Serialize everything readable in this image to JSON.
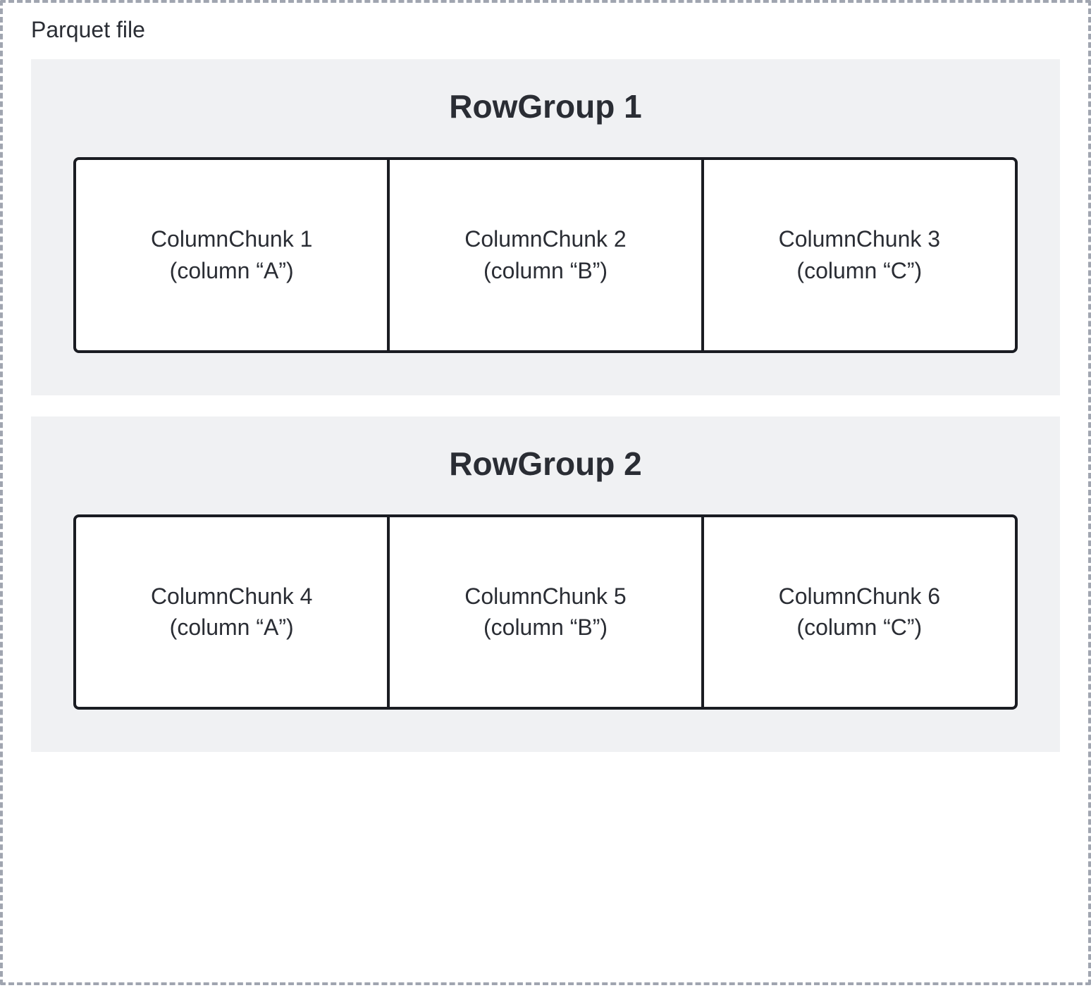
{
  "container_label": "Parquet file",
  "rowgroups": [
    {
      "title": "RowGroup 1",
      "chunks": [
        {
          "label": "ColumnChunk 1",
          "sublabel": "(column “A”)"
        },
        {
          "label": "ColumnChunk 2",
          "sublabel": "(column “B”)"
        },
        {
          "label": "ColumnChunk 3",
          "sublabel": "(column “C”)"
        }
      ]
    },
    {
      "title": "RowGroup 2",
      "chunks": [
        {
          "label": "ColumnChunk 4",
          "sublabel": "(column “A”)"
        },
        {
          "label": "ColumnChunk 5",
          "sublabel": "(column “B”)"
        },
        {
          "label": "ColumnChunk 6",
          "sublabel": "(column “C”)"
        }
      ]
    }
  ]
}
